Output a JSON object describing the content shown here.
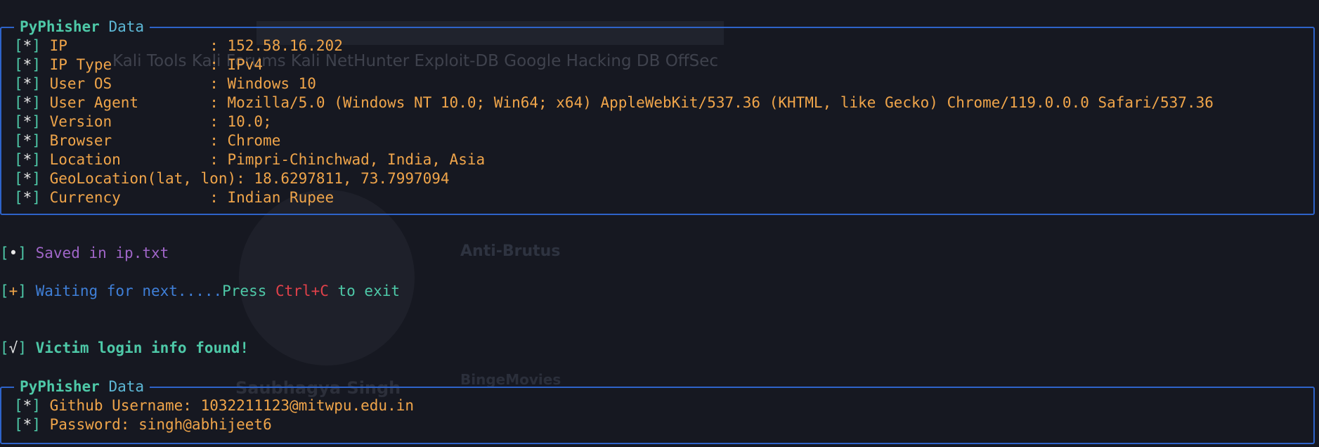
{
  "background": {
    "bookmarks": "Kali Tools   Kali Forums   Kali NetHunter   Exploit-DB   Google Hacking DB   OffSec",
    "profile_name": "Saubhagya Singh",
    "repo1": "Anti-Brutus",
    "repo2": "BingeMovies"
  },
  "panel1": {
    "title_brand": "PyPhisher",
    "title_suffix": "Data",
    "rows": [
      {
        "key": "IP                ",
        "value": "152.58.16.202"
      },
      {
        "key": "IP Type           ",
        "value": "IPv4"
      },
      {
        "key": "User OS           ",
        "value": "Windows 10"
      },
      {
        "key": "User Agent        ",
        "value": "Mozilla/5.0 (Windows NT 10.0; Win64; x64) AppleWebKit/537.36 (KHTML, like Gecko) Chrome/119.0.0.0 Safari/537.36"
      },
      {
        "key": "Version           ",
        "value": "10.0;"
      },
      {
        "key": "Browser           ",
        "value": "Chrome"
      },
      {
        "key": "Location          ",
        "value": "Pimpri-Chinchwad, India, Asia"
      },
      {
        "key": "GeoLocation(lat, lon)",
        "value": "18.6297811, 73.7997094"
      },
      {
        "key": "Currency          ",
        "value": "Indian Rupee"
      }
    ]
  },
  "messages": {
    "saved_prefix": "•",
    "saved_text": "Saved in ip.txt",
    "wait_prefix": "+",
    "wait_text": "Waiting for next.....",
    "press_text": "Press ",
    "ctrl_text": "Ctrl+C",
    "exit_text": " to exit",
    "found_prefix": "√",
    "found_text": "Victim login info found!"
  },
  "panel2": {
    "title_brand": "PyPhisher",
    "title_suffix": "Data",
    "rows": [
      {
        "key": "Github Username",
        "value": "1032211123@mitwpu.edu.in"
      },
      {
        "key": "Password",
        "value": "singh@abhijeet6"
      }
    ]
  },
  "colors": {
    "border": "#2e63c9",
    "bracket": "#4ec9a8",
    "key": "#f0a54a",
    "purple": "#a066c8",
    "blue": "#3f7fd8",
    "red": "#e0414a"
  }
}
